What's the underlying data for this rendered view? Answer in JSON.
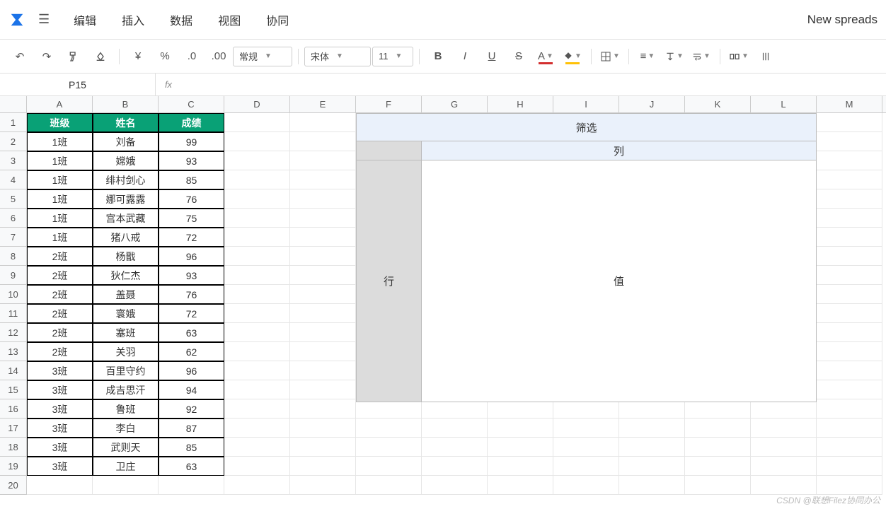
{
  "menubar": {
    "items": [
      "编辑",
      "插入",
      "数据",
      "视图",
      "协同"
    ]
  },
  "title": "New spreads",
  "toolbar": {
    "number_format": "常规",
    "font_family": "宋体",
    "font_size": "11"
  },
  "formula_bar": {
    "name_box": "P15",
    "fx": "fx",
    "formula": ""
  },
  "columns": [
    "A",
    "B",
    "C",
    "D",
    "E",
    "F",
    "G",
    "H",
    "I",
    "J",
    "K",
    "L",
    "M"
  ],
  "rows": [
    "1",
    "2",
    "3",
    "4",
    "5",
    "6",
    "7",
    "8",
    "9",
    "10",
    "11",
    "12",
    "13",
    "14",
    "15",
    "16",
    "17",
    "18",
    "19",
    "20"
  ],
  "table": {
    "headers": [
      "班级",
      "姓名",
      "成绩"
    ],
    "data": [
      [
        "1班",
        "刘备",
        "99"
      ],
      [
        "1班",
        "嫦娥",
        "93"
      ],
      [
        "1班",
        "绯村剑心",
        "85"
      ],
      [
        "1班",
        "娜可露露",
        "76"
      ],
      [
        "1班",
        "宫本武藏",
        "75"
      ],
      [
        "1班",
        "猪八戒",
        "72"
      ],
      [
        "2班",
        "杨戬",
        "96"
      ],
      [
        "2班",
        "狄仁杰",
        "93"
      ],
      [
        "2班",
        "盖聂",
        "76"
      ],
      [
        "2班",
        "寰娥",
        "72"
      ],
      [
        "2班",
        "塞班",
        "63"
      ],
      [
        "2班",
        "关羽",
        "62"
      ],
      [
        "3班",
        "百里守约",
        "96"
      ],
      [
        "3班",
        "成吉思汗",
        "94"
      ],
      [
        "3班",
        "鲁班",
        "92"
      ],
      [
        "3班",
        "李白",
        "87"
      ],
      [
        "3班",
        "武则天",
        "85"
      ],
      [
        "3班",
        "卫庄",
        "63"
      ]
    ]
  },
  "pivot": {
    "filter": "筛选",
    "column": "列",
    "row": "行",
    "values": "值"
  },
  "watermark": "CSDN @联想Filez协同办公"
}
